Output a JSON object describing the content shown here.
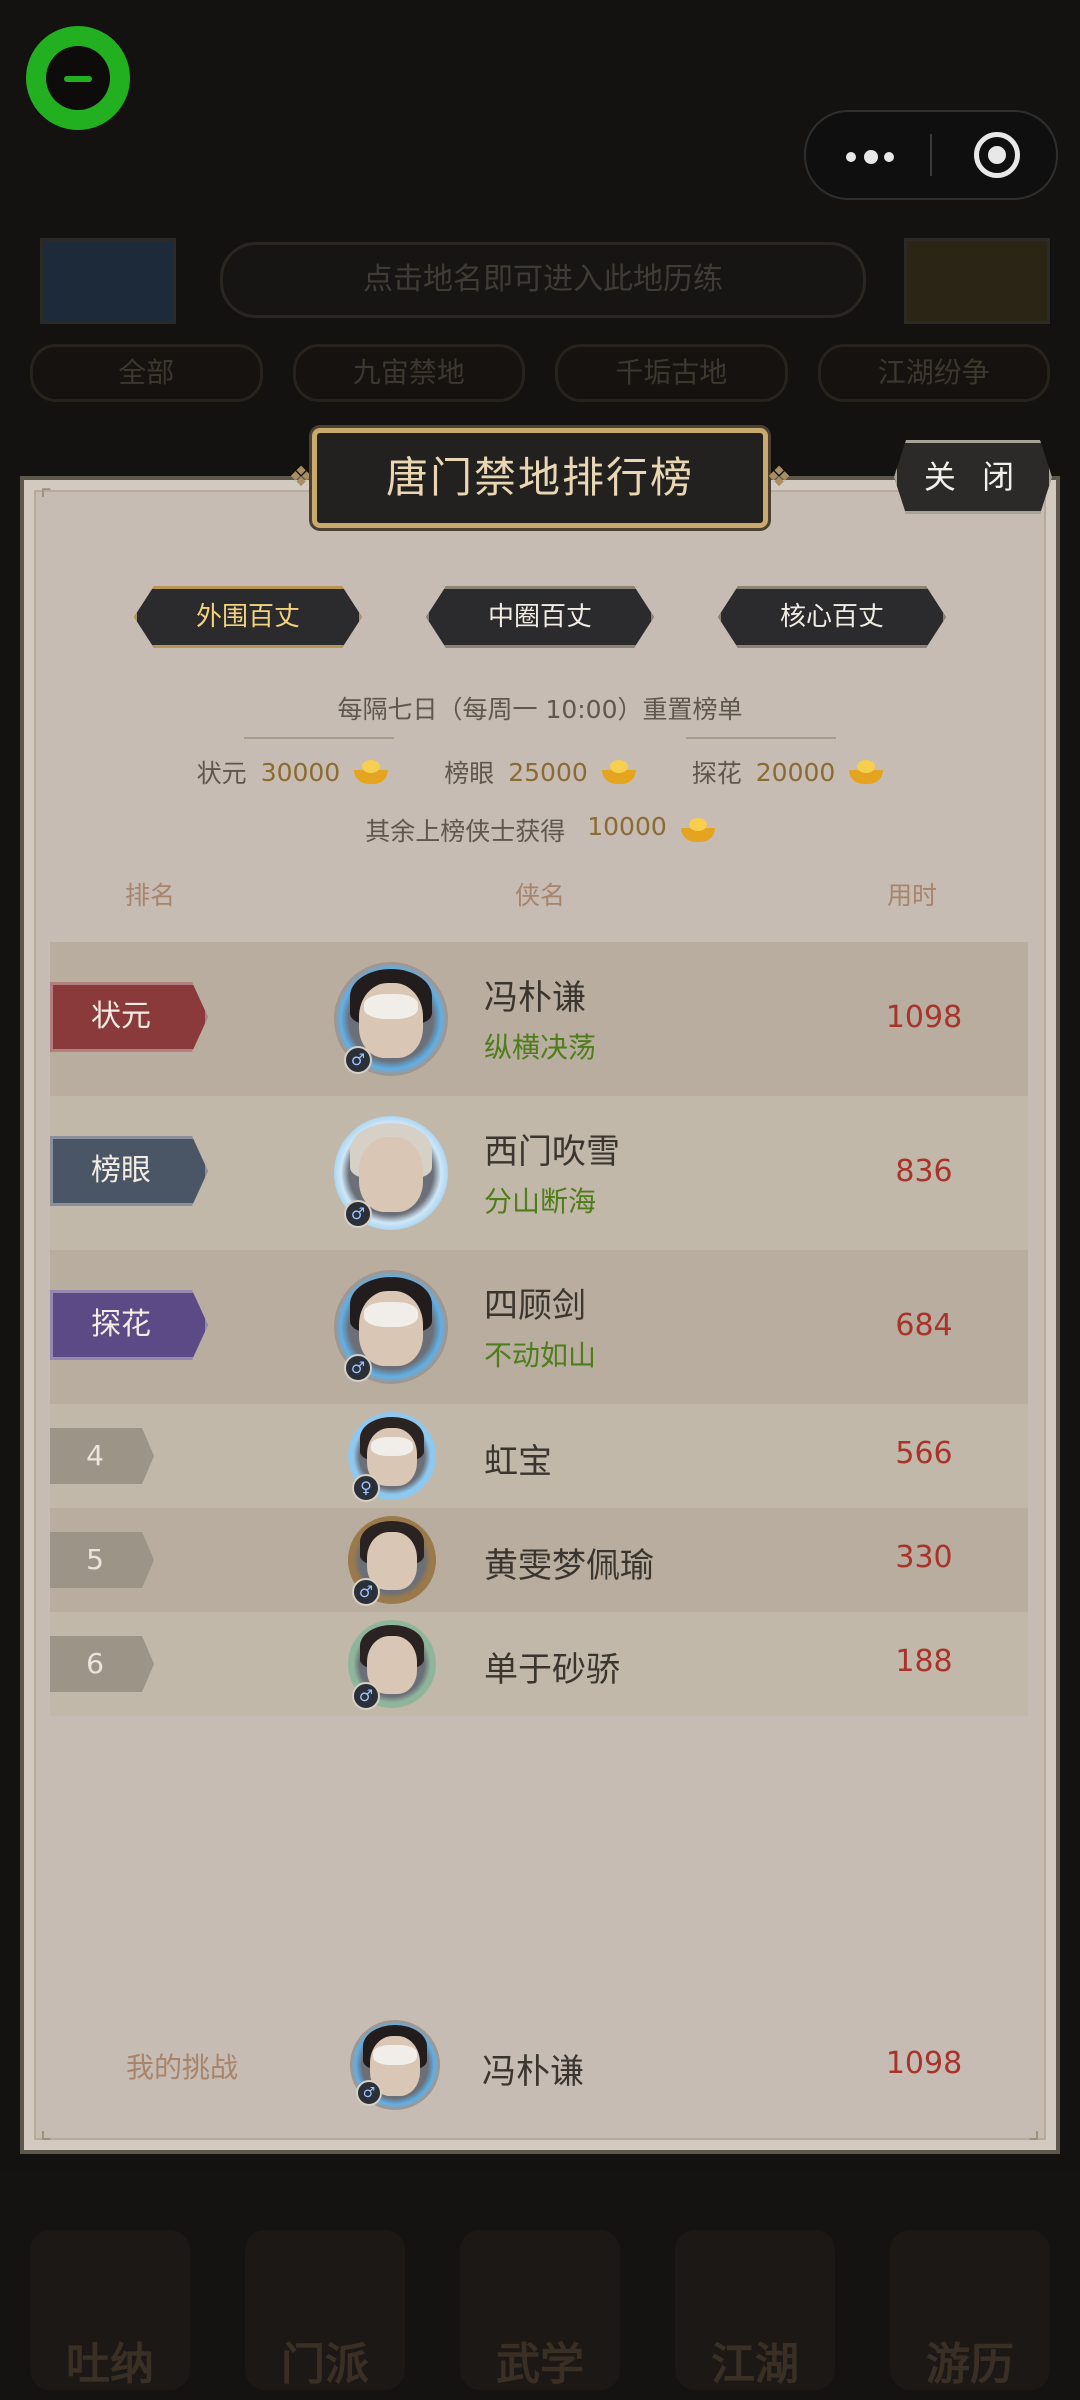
{
  "background": {
    "hint_text": "点击地名即可进入此地历练",
    "tabs": [
      "全部",
      "九宙禁地",
      "千垢古地",
      "江湖纷争"
    ],
    "bottom_nav": [
      "吐纳",
      "门派",
      "武学",
      "江湖",
      "游历"
    ]
  },
  "modal": {
    "title": "唐门禁地排行榜",
    "close_label": "关 闭",
    "tabs": [
      {
        "label": "外围百丈",
        "active": true
      },
      {
        "label": "中圈百丈",
        "active": false
      },
      {
        "label": "核心百丈",
        "active": false
      }
    ],
    "reset_info": "每隔七日（每周一 10:00）重置榜单",
    "prizes": [
      {
        "title": "状元",
        "amount": "30000"
      },
      {
        "title": "榜眼",
        "amount": "25000"
      },
      {
        "title": "探花",
        "amount": "20000"
      }
    ],
    "others_prize_label": "其余上榜侠士获得",
    "others_prize_amount": "10000",
    "columns": {
      "rank": "排名",
      "name": "侠名",
      "time": "用时"
    },
    "rows": [
      {
        "rank": "状元",
        "badge_color": "#8a3a3a",
        "name": "冯朴谦",
        "title": "纵横决荡",
        "time": "1098",
        "ring": "#e8782a",
        "glow": "#5fb0e8",
        "hair": "#221d1c",
        "mask": true
      },
      {
        "rank": "榜眼",
        "badge_color": "#4a5566",
        "name": "西门吹雪",
        "title": "分山断海",
        "time": "836",
        "ring": "#8ec8ef",
        "glow": "#cfe7f7",
        "hair": "#d7d0c7",
        "mask": false
      },
      {
        "rank": "探花",
        "badge_color": "#5b4a86",
        "name": "四顾剑",
        "title": "不动如山",
        "time": "684",
        "ring": "#e8782a",
        "glow": "#5fb0e8",
        "hair": "#221d1c",
        "mask": true
      },
      {
        "rank": "4",
        "name": "虹宝",
        "time": "566",
        "ring": "#8ec8ef",
        "hair": "#2a2322",
        "mask": true
      },
      {
        "rank": "5",
        "name": "黄雯梦佩瑜",
        "time": "330",
        "ring": "#9a7a4a",
        "hair": "#2a2322",
        "mask": false
      },
      {
        "rank": "6",
        "name": "单于砂骄",
        "time": "188",
        "ring": "#8fb59a",
        "hair": "#2a2322",
        "mask": false
      }
    ],
    "my_challenge": {
      "label": "我的挑战",
      "name": "冯朴谦",
      "time": "1098"
    }
  }
}
